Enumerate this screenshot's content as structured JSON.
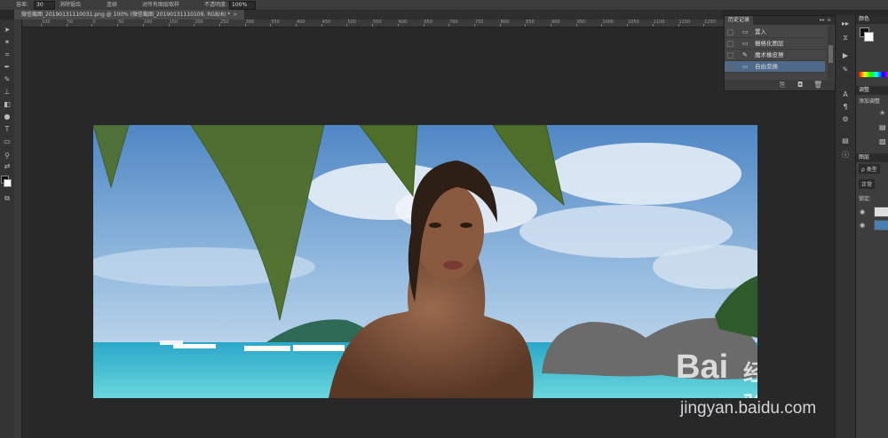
{
  "options_bar": {
    "tolerance_label": "容差:",
    "tolerance_value": "30",
    "antialias_label": "消除锯齿",
    "contiguous_label": "连续",
    "sample_all_label": "对所有图层取样",
    "opacity_label": "不透明度:",
    "opacity_value": "100%"
  },
  "document": {
    "tab_title": "微信截图_20190131110031.png @ 100% (微信截图_20190131110109, RGB/8) *",
    "close_symbol": "×"
  },
  "ruler": {
    "ticks": [
      "100",
      "50",
      "0",
      "50",
      "100",
      "150",
      "200",
      "250",
      "300",
      "350",
      "400",
      "450",
      "500",
      "550",
      "600",
      "650",
      "700",
      "750",
      "800",
      "850",
      "900",
      "950",
      "1000",
      "1050",
      "1100",
      "1150",
      "1200"
    ]
  },
  "history_panel": {
    "title": "历史记录",
    "menu_symbol": "▸▸ ≡",
    "items": [
      {
        "label": "置入",
        "icon": "▭",
        "active": false
      },
      {
        "label": "栅格化图层",
        "icon": "▭",
        "active": false
      },
      {
        "label": "魔术橡皮擦",
        "icon": "✎",
        "active": false
      },
      {
        "label": "自由变换",
        "icon": "▭",
        "active": true
      }
    ],
    "footer_icons": [
      "⎘",
      "◘",
      "🗑"
    ]
  },
  "right_dock": {
    "color_tab": "颜色",
    "adjust_tab": "调整",
    "adjust_add": "添加调整",
    "layers_tab": "图层",
    "kind_label": "ρ 类型",
    "blend_mode": "正常",
    "lock_label": "锁定:"
  },
  "watermark": {
    "brand": "Bai",
    "brand2": "经验",
    "url": "jingyan.baidu.com"
  },
  "colors": {
    "panel_bg": "#454545",
    "active_row": "#4e6a8a",
    "canvas_bg": "#282828"
  }
}
